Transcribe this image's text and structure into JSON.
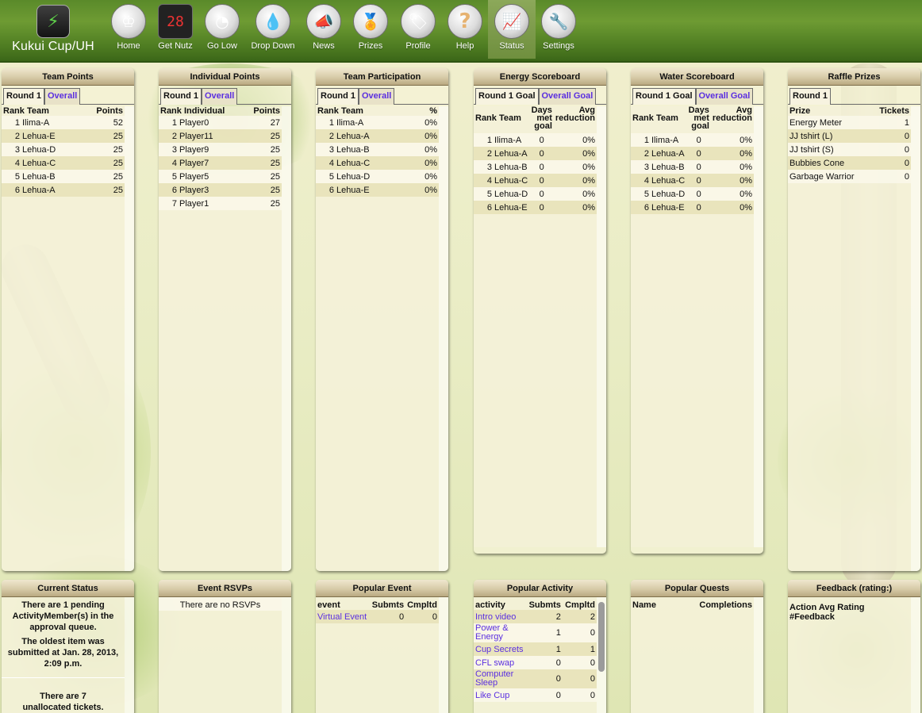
{
  "app": {
    "title": "Kukui Cup/UH"
  },
  "nav": [
    {
      "label": "Home",
      "icon": "trophy-icon",
      "glyph": "♔"
    },
    {
      "label": "Get Nutz",
      "icon": "scoreboard-icon",
      "glyph": "28"
    },
    {
      "label": "Go Low",
      "icon": "gauge-icon",
      "glyph": "◔"
    },
    {
      "label": "Drop Down",
      "icon": "water-drop-icon",
      "glyph": "💧"
    },
    {
      "label": "News",
      "icon": "megaphone-icon",
      "glyph": "📣"
    },
    {
      "label": "Prizes",
      "icon": "medal-icon",
      "glyph": "🏅"
    },
    {
      "label": "Profile",
      "icon": "profile-tag-icon",
      "glyph": "🏷"
    },
    {
      "label": "Help",
      "icon": "help-icon",
      "glyph": "?"
    },
    {
      "label": "Status",
      "icon": "status-chart-icon",
      "glyph": "📈"
    },
    {
      "label": "Settings",
      "icon": "wrench-icon",
      "glyph": "🔧"
    }
  ],
  "team_points": {
    "title": "Team Points",
    "tabs": [
      "Round 1",
      "Overall"
    ],
    "headers": [
      "Rank Team",
      "Points"
    ],
    "rows": [
      {
        "rank": "1",
        "name": "Ilima-A",
        "val": "52"
      },
      {
        "rank": "2",
        "name": "Lehua-E",
        "val": "25"
      },
      {
        "rank": "3",
        "name": "Lehua-D",
        "val": "25"
      },
      {
        "rank": "4",
        "name": "Lehua-C",
        "val": "25"
      },
      {
        "rank": "5",
        "name": "Lehua-B",
        "val": "25"
      },
      {
        "rank": "6",
        "name": "Lehua-A",
        "val": "25"
      }
    ]
  },
  "individual_points": {
    "title": "Individual Points",
    "tabs": [
      "Round 1",
      "Overall"
    ],
    "headers": [
      "Rank Individual",
      "Points"
    ],
    "rows": [
      {
        "rank": "1",
        "name": "Player0",
        "val": "27"
      },
      {
        "rank": "2",
        "name": "Player11",
        "val": "25"
      },
      {
        "rank": "3",
        "name": "Player9",
        "val": "25"
      },
      {
        "rank": "4",
        "name": "Player7",
        "val": "25"
      },
      {
        "rank": "5",
        "name": "Player5",
        "val": "25"
      },
      {
        "rank": "6",
        "name": "Player3",
        "val": "25"
      },
      {
        "rank": "7",
        "name": "Player1",
        "val": "25"
      }
    ]
  },
  "team_participation": {
    "title": "Team Participation",
    "tabs": [
      "Round 1",
      "Overall"
    ],
    "headers": [
      "Rank Team",
      "%"
    ],
    "rows": [
      {
        "rank": "1",
        "name": "Ilima-A",
        "val": "0%"
      },
      {
        "rank": "2",
        "name": "Lehua-A",
        "val": "0%"
      },
      {
        "rank": "3",
        "name": "Lehua-B",
        "val": "0%"
      },
      {
        "rank": "4",
        "name": "Lehua-C",
        "val": "0%"
      },
      {
        "rank": "5",
        "name": "Lehua-D",
        "val": "0%"
      },
      {
        "rank": "6",
        "name": "Lehua-E",
        "val": "0%"
      }
    ]
  },
  "energy_scoreboard": {
    "title": "Energy Scoreboard",
    "tabs": [
      "Round 1 Goal",
      "Overall Goal"
    ],
    "headers": [
      "Rank Team",
      "Days met goal",
      "Avg reduction"
    ],
    "rows": [
      {
        "rank": "1",
        "name": "Ilima-A",
        "days": "0",
        "avg": "0%"
      },
      {
        "rank": "2",
        "name": "Lehua-A",
        "days": "0",
        "avg": "0%"
      },
      {
        "rank": "3",
        "name": "Lehua-B",
        "days": "0",
        "avg": "0%"
      },
      {
        "rank": "4",
        "name": "Lehua-C",
        "days": "0",
        "avg": "0%"
      },
      {
        "rank": "5",
        "name": "Lehua-D",
        "days": "0",
        "avg": "0%"
      },
      {
        "rank": "6",
        "name": "Lehua-E",
        "days": "0",
        "avg": "0%"
      }
    ]
  },
  "water_scoreboard": {
    "title": "Water Scoreboard",
    "tabs": [
      "Round 1 Goal",
      "Overall Goal"
    ],
    "headers": [
      "Rank Team",
      "Days met goal",
      "Avg reduction"
    ],
    "rows": [
      {
        "rank": "1",
        "name": "Ilima-A",
        "days": "0",
        "avg": "0%"
      },
      {
        "rank": "2",
        "name": "Lehua-A",
        "days": "0",
        "avg": "0%"
      },
      {
        "rank": "3",
        "name": "Lehua-B",
        "days": "0",
        "avg": "0%"
      },
      {
        "rank": "4",
        "name": "Lehua-C",
        "days": "0",
        "avg": "0%"
      },
      {
        "rank": "5",
        "name": "Lehua-D",
        "days": "0",
        "avg": "0%"
      },
      {
        "rank": "6",
        "name": "Lehua-E",
        "days": "0",
        "avg": "0%"
      }
    ]
  },
  "raffle_prizes": {
    "title": "Raffle Prizes",
    "tabs": [
      "Round 1"
    ],
    "headers": [
      "Prize",
      "Tickets"
    ],
    "rows": [
      {
        "name": "Energy Meter",
        "val": "1"
      },
      {
        "name": "JJ tshirt (L)",
        "val": "0"
      },
      {
        "name": "JJ tshirt (S)",
        "val": "0"
      },
      {
        "name": "Bubbies Cone",
        "val": "0"
      },
      {
        "name": "Garbage Warrior",
        "val": "0"
      }
    ]
  },
  "current_status": {
    "title": "Current Status",
    "pending": "There are 1 pending ActivityMember(s) in the approval queue.",
    "oldest": "The oldest item was submitted at Jan. 28, 2013, 2:09 p.m.",
    "tickets": "There are 7 unallocated tickets."
  },
  "event_rsvps": {
    "title": "Event RSVPs",
    "empty": "There are no RSVPs"
  },
  "popular_event": {
    "title": "Popular Event",
    "headers": [
      "event",
      "Submts",
      "Cmpltd"
    ],
    "rows": [
      {
        "name": "Virtual Event",
        "sub": "0",
        "cmp": "0"
      }
    ]
  },
  "popular_activity": {
    "title": "Popular Activity",
    "headers": [
      "activity",
      "Submts",
      "Cmpltd"
    ],
    "rows": [
      {
        "name": "Intro video",
        "sub": "2",
        "cmp": "2"
      },
      {
        "name": "Power & Energy",
        "sub": "1",
        "cmp": "0"
      },
      {
        "name": "Cup Secrets",
        "sub": "1",
        "cmp": "1"
      },
      {
        "name": "CFL swap",
        "sub": "0",
        "cmp": "0"
      },
      {
        "name": "Computer Sleep",
        "sub": "0",
        "cmp": "0"
      },
      {
        "name": "Like Cup",
        "sub": "0",
        "cmp": "0"
      }
    ]
  },
  "popular_quests": {
    "title": "Popular Quests",
    "headers": [
      "Name",
      "Completions"
    ]
  },
  "feedback": {
    "title": "Feedback (rating:)",
    "headers": "Action Avg Rating #Feedback"
  }
}
